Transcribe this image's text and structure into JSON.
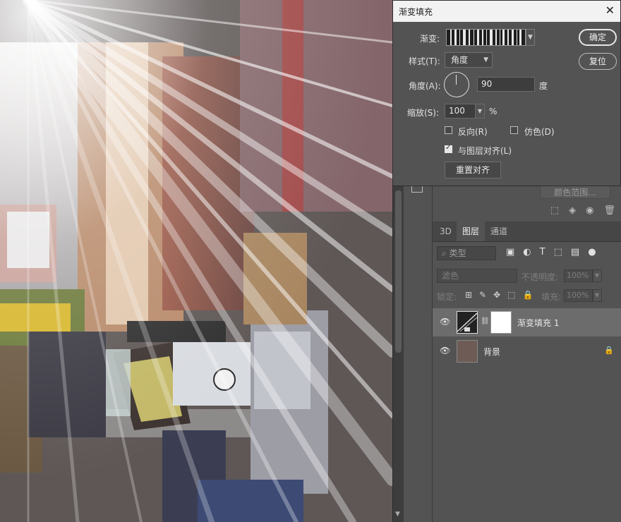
{
  "dialog": {
    "title": "渐变填充",
    "gradient_label": "渐变:",
    "style_label": "样式(T):",
    "style_value": "角度",
    "angle_label": "角度(A):",
    "angle_value": "90",
    "angle_unit": "度",
    "scale_label": "缩放(S):",
    "scale_value": "100",
    "scale_unit": "%",
    "reverse_label": "反向(R)",
    "reverse_checked": false,
    "dither_label": "仿色(D)",
    "dither_checked": false,
    "align_label": "与图层对齐(L)",
    "align_checked": true,
    "reset_align_label": "重置对齐",
    "ok_label": "确定",
    "reset_label": "复位"
  },
  "adjust_panel": {
    "color_range_label": "颜色范围..."
  },
  "layers_panel": {
    "tabs": [
      {
        "label": "3D",
        "active": false
      },
      {
        "label": "图层",
        "active": true
      },
      {
        "label": "通道",
        "active": false
      }
    ],
    "filter_kind": "类型",
    "blend_mode": "滤色",
    "opacity_label": "不透明度:",
    "opacity_value": "100%",
    "lock_label": "锁定:",
    "fill_label": "填充:",
    "fill_value": "100%",
    "layers": [
      {
        "name": "渐变填充 1",
        "selected": true,
        "visible": true,
        "locked": false
      },
      {
        "name": "背景",
        "selected": false,
        "visible": true,
        "locked": true
      }
    ]
  },
  "icons": {
    "close": "close-icon",
    "dropdown": "chevron-down-icon",
    "eye": "eye-icon",
    "lock": "lock-icon",
    "search": "search-icon",
    "link": "link-icon"
  },
  "colors": {
    "panel_bg": "#535353",
    "dialog_title_bg": "#f2f2f2",
    "selected_layer_bg": "#6c6c6c"
  }
}
